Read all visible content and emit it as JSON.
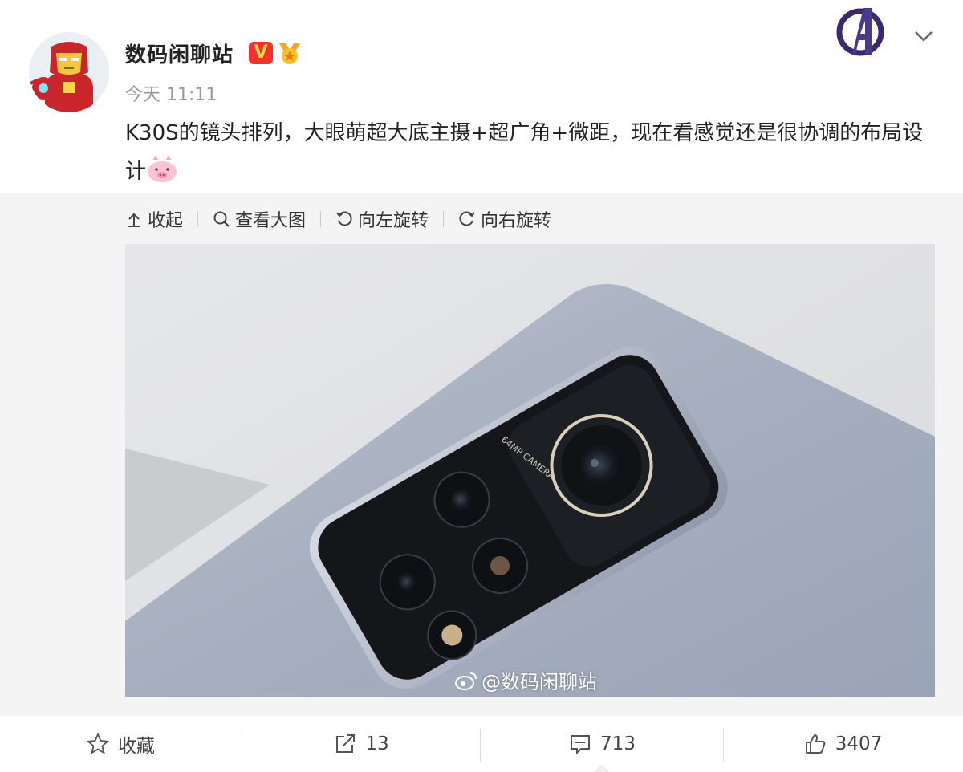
{
  "post": {
    "username": "数码闲聊站",
    "verified_badge": "V",
    "timestamp": "今天 11:11",
    "text": "K30S的镜头排列，大眼萌超大底主摄+超广角+微距，现在看感觉还是很协调的布局设计"
  },
  "icons": {
    "avatar": "ironman-avatar",
    "verified": "verified-v-icon",
    "medal": "medal-icon",
    "emoji": "pig-emoji",
    "top_right": "avengers-icon",
    "menu": "chevron-down-icon"
  },
  "media_toolbar": {
    "collapse": "收起",
    "view_large": "查看大图",
    "rotate_left": "向左旋转",
    "rotate_right": "向右旋转"
  },
  "photo": {
    "camera_label": "64MP CAMERA",
    "watermark": "@数码闲聊站"
  },
  "actions": {
    "favorite": "收藏",
    "repost": "13",
    "comment": "713",
    "like": "3407"
  },
  "colors": {
    "verified_red": "#f3332b",
    "panel_bg": "#f4f4f4",
    "phone_body": "#a8b0bf"
  }
}
